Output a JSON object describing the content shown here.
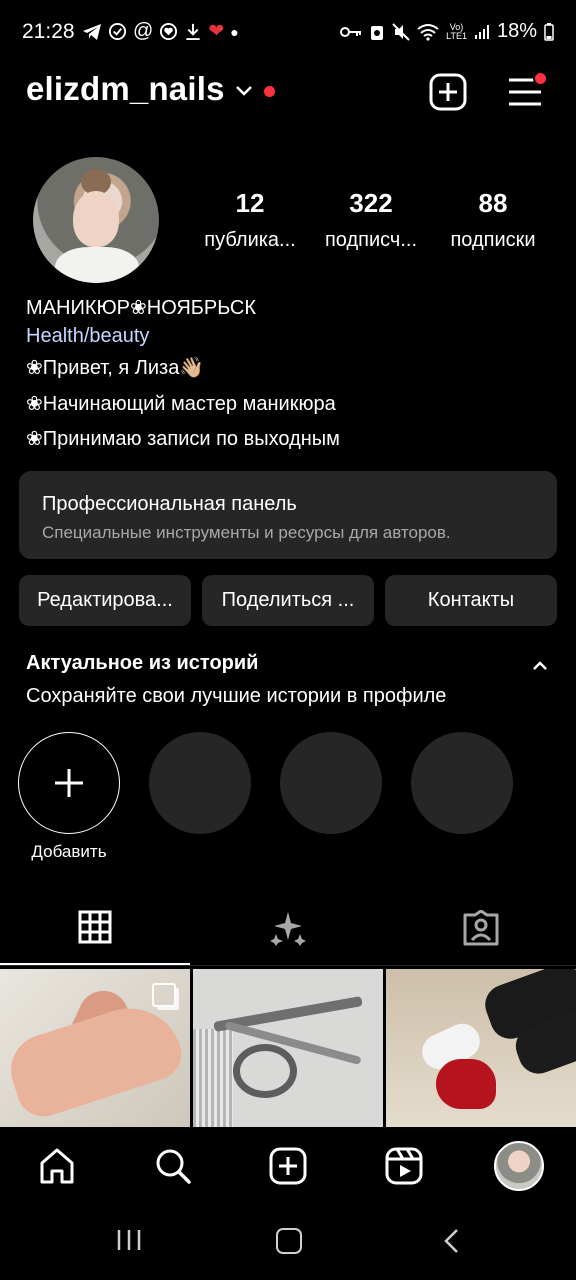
{
  "status_bar": {
    "time": "21:28",
    "battery": "18%",
    "left_icons": [
      "telegram-icon",
      "check-circle-icon",
      "at-icon",
      "heart-chat-icon",
      "download-icon",
      "heart-icon",
      "dot-icon"
    ],
    "right_icons": [
      "key-icon",
      "recycle-icon",
      "mute-icon",
      "wifi-icon",
      "volte-icon",
      "signal-icon",
      "battery-icon"
    ]
  },
  "header": {
    "username": "elizdm_nails"
  },
  "profile": {
    "stats": [
      {
        "num": "12",
        "label": "публика..."
      },
      {
        "num": "322",
        "label": "подписч..."
      },
      {
        "num": "88",
        "label": "подписки"
      }
    ],
    "name": "МАНИКЮР❀НОЯБРЬСК",
    "category": "Health/beauty",
    "bio_lines": [
      "❀Привет, я Лиза👋🏼",
      "❀Начинающий мастер маникюра",
      "❀Принимаю записи по выходным"
    ]
  },
  "pro_panel": {
    "title": "Профессиональная панель",
    "subtitle": "Специальные инструменты и ресурсы для авторов."
  },
  "buttons": {
    "edit": "Редактирова...",
    "share": "Поделиться ...",
    "contacts": "Контакты"
  },
  "highlights": {
    "title": "Актуальное из историй",
    "subtitle": "Сохраняйте свои лучшие истории в профиле",
    "add_label": "Добавить"
  },
  "colors": {
    "background": "#000000",
    "surface": "#262626",
    "accent_red": "#ff3040",
    "category_link": "#c7d6ff"
  }
}
